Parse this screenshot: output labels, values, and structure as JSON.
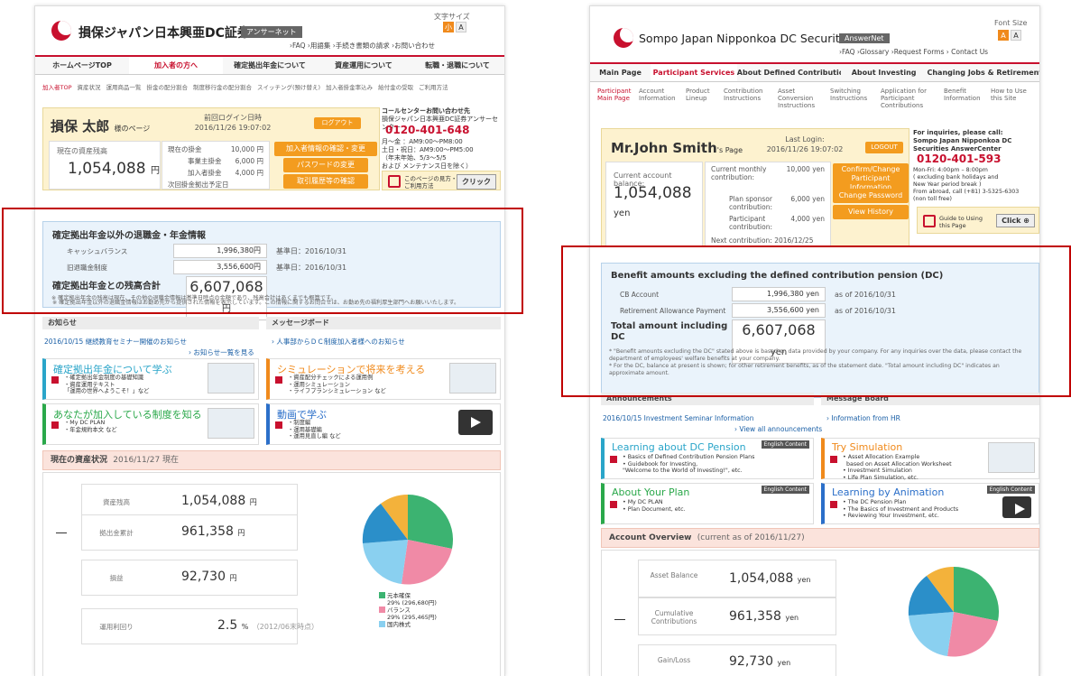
{
  "jp": {
    "brand": "損保ジャパン日本興亜DC証券",
    "answer_net": "アンサーネット",
    "font_size_label": "文字サイズ",
    "font_small": "小",
    "font_large": "A",
    "top_links": "›FAQ  ›用語集  ›手続き書類の請求  ›お問い合わせ",
    "nav": [
      "ホームページTOP",
      "加入者の方へ",
      "確定拠出年金について",
      "資産運用について",
      "転職・退職について"
    ],
    "subnav": [
      "加入者TOP",
      "資産状況",
      "運用商品一覧",
      "掛金の配分割合",
      "制度移行金の配分割合",
      "スイッチング(預け替え)",
      "加入者掛金率込み",
      "給付金の受取",
      "ご利用方法"
    ],
    "user": {
      "name": "損保 太郎",
      "page_suffix": "様のページ",
      "last_login_label": "前回ログイン日時",
      "last_login": "2016/11/26 19:07:02",
      "logout": "ログアウト"
    },
    "balance_label": "現在の資産残高",
    "balance": "1,054,088",
    "yen": "円",
    "contrib": [
      {
        "label": "現在の掛金",
        "value": "10,000 円"
      },
      {
        "label": "事業主掛金",
        "value": "6,000 円"
      },
      {
        "label": "加入者掛金",
        "value": "4,000 円"
      },
      {
        "label": "次回掛金拠出予定日",
        "value": "2016/12/25"
      }
    ],
    "buttons": [
      "加入者情報の確認・変更",
      "パスワードの変更",
      "取引履歴等の確認"
    ],
    "call": {
      "title": "コールセンターお問い合わせ先",
      "sub": "損保ジャパン日本興亜DC証券アンサーセンター",
      "phone": "0120-401-648",
      "hours": [
        "月〜金 ：AM9:00〜PM8:00",
        "土日・祝日：AM9:00〜PM5:00",
        "（年末年始、5/3〜5/5",
        "および メンテナンス日を除く）"
      ]
    },
    "guide": {
      "text": "このページの見方・ご利用方法",
      "click": "クリック"
    },
    "benefit": {
      "title": "確定拠出年金以外の退職金・年金情報",
      "rows": [
        {
          "label": "キャッシュバランス",
          "value": "1,996,380円",
          "basis": "基準日：2016/10/31"
        },
        {
          "label": "旧退職金制度",
          "value": "3,556,600円",
          "basis": "基準日：2016/10/31"
        }
      ],
      "total_label": "確定拠出年金との残高合計",
      "total": "6,607,068",
      "yen": "円",
      "notes": [
        "※ 確定拠出年金以外の退職金情報はお勤め先から提供された情報を表示しています。この情報に関するお問合せは、お勤め先の福利厚生部門へお願いいたします。",
        "※ 確定拠出年金の残高は現在、その他の退職金情報は基準日時点の金額であり、残高合計はあくまでも概算です。"
      ]
    },
    "announcements": "お知らせ",
    "message_board": "メッセージボード",
    "news1": "2016/10/15 継続教育セミナー開催のお知らせ",
    "news_all": "› お知らせ一覧を見る",
    "msg1": "› 人事部からＤＣ制度加入者様へのお知らせ",
    "cards": [
      {
        "title": "確定拠出年金について学ぶ",
        "desc": "・確定拠出年金制度の基礎知識\n・資産運用テキスト\n「運用の世界へようこそ！」など"
      },
      {
        "title": "シミュレーションで将来を考える",
        "desc": "・資産配分チェックによる運用例\n・運用シミュレーション\n・ライフプランシミュレーション など"
      },
      {
        "title": "あなたが加入している制度を知る",
        "desc": "・My DC PLAN\n・年金規約本文 など"
      },
      {
        "title": "動画で学ぶ",
        "desc": "・制度編\n・運用基礎編\n・運用見直し編 など"
      }
    ],
    "overview": {
      "title": "現在の資産状況",
      "date": "2016/11/27 現在",
      "rows": [
        {
          "label": "資産残高",
          "value": "1,054,088",
          "unit": "円"
        },
        {
          "label": "拠出金累計",
          "value": "961,358",
          "unit": "円"
        },
        {
          "label": "損益",
          "value": "92,730",
          "unit": "円"
        },
        {
          "label": "運用利回り",
          "value": "2.5",
          "unit": "%",
          "extra": "（2012/06末時点）"
        }
      ]
    },
    "legend": [
      {
        "label": "元本確保",
        "sub": "29% (296,680円)",
        "color": "#3cb371"
      },
      {
        "label": "バランス",
        "sub": "29% (295,465円)",
        "color": "#f08aa6"
      },
      {
        "label": "国内株式",
        "sub": "",
        "color": "#8ad0f0"
      }
    ]
  },
  "en": {
    "brand": "Sompo Japan Nipponkoa DC Securities",
    "answer_net": "AnswerNet",
    "font_size_label": "Font Size",
    "font_small": "A",
    "font_large": "A",
    "top_links": "›FAQ  ›Glossary  ›Request Forms  › Contact Us",
    "nav": [
      "Main Page",
      "Participant Services",
      "About Defined Contribution",
      "About Investing",
      "Changing Jobs & Retirement"
    ],
    "subnav": [
      "Participant Main Page",
      "Account Information",
      "Product Lineup",
      "Contribution Instructions",
      "Asset Conversion Instructions",
      "Switching Instructions",
      "Application for Participant Contributions",
      "Benefit Information",
      "How to Use this Site"
    ],
    "user": {
      "name": "Mr.John Smith",
      "page_suffix": "'s Page",
      "last_login_label": "Last Login:",
      "last_login": "2016/11/26 19:07:02",
      "logout": "LOGOUT"
    },
    "balance_label": "Current account balance:",
    "balance": "1,054,088",
    "yen": "yen",
    "contrib": [
      {
        "label": "Current monthly contribution:",
        "value": "10,000 yen"
      },
      {
        "label": "Plan sponsor contribution:",
        "value": "6,000 yen"
      },
      {
        "label": "Participant contribution:",
        "value": "4,000 yen"
      },
      {
        "label": "Next contribution:",
        "value": "2016/12/25"
      }
    ],
    "buttons": [
      "Confirm/Change Participant Information",
      "Change Password",
      "View History"
    ],
    "call": {
      "title": "For inquiries, please call:",
      "sub": "Sompo Japan Nipponkoa DC Securities AnswerCenter",
      "phone": "0120-401-593",
      "hours": [
        "Mon-Fri: 4:00pm – 8:00pm",
        "( excluding bank holidays and",
        "New Year period break )",
        "From abroad, call (+81) 3-5325-6303",
        "(non toll free)"
      ]
    },
    "guide": {
      "text": "Guide to Using this Page",
      "click": "Click"
    },
    "benefit": {
      "title": "Benefit amounts excluding the defined contribution pension (DC)",
      "rows": [
        {
          "label": "CB Account",
          "value": "1,996,380 yen",
          "basis": "as of 2016/10/31"
        },
        {
          "label": "Retirement Allowance Payment",
          "value": "3,556,600 yen",
          "basis": "as of 2016/10/31"
        }
      ],
      "total_label": "Total amount including DC",
      "total": "6,607,068",
      "yen": "yen",
      "notes": [
        "* \"Benefit amounts excluding the DC\" stated above is based on data provided by your company. For any inquiries over the data, please contact the department of employees' welfare benefits at your company.",
        "* For the DC, balance at present is shown; for other retirement benefits, as of the statement date. \"Total amount including DC\" indicates an approximate amount."
      ]
    },
    "announcements": "Announcements",
    "message_board": "Message Board",
    "news1": "2016/10/15 Investment Seminar Information",
    "news_all": "› View all announcements",
    "msg1": "› Information from HR",
    "cards": [
      {
        "title": "Learning about DC Pension",
        "desc": "• Basics of Defined Contribution Pension Plans\n• Guidebook for Investing,\n\"Welcome to the World of Investing!\", etc.",
        "badge": "English Content"
      },
      {
        "title": "Try Simulation",
        "desc": "• Asset Allocation Example\n  based on Asset Allocation Worksheet\n• Investment Simulation\n• Life Plan Simulation, etc."
      },
      {
        "title": "About Your Plan",
        "desc": "• My DC PLAN\n• Plan Document, etc.",
        "badge": "English Content"
      },
      {
        "title": "Learning by Animation",
        "desc": "• The DC Pension Plan\n• The Basics of Investment and Products\n• Reviewing Your Investment, etc.",
        "badge": "English Content"
      }
    ],
    "overview": {
      "title": "Account Overview",
      "date": "(current as of 2016/11/27)",
      "rows": [
        {
          "label": "Asset Balance",
          "value": "1,054,088",
          "unit": "yen"
        },
        {
          "label": "Cumulative Contributions",
          "value": "961,358",
          "unit": "yen"
        },
        {
          "label": "Gain/Loss",
          "value": "92,730",
          "unit": "yen"
        }
      ]
    }
  },
  "pie_colors": [
    "#3cb371",
    "#f08aa6",
    "#8ad0f0",
    "#2b8fc9",
    "#f3b23b"
  ]
}
